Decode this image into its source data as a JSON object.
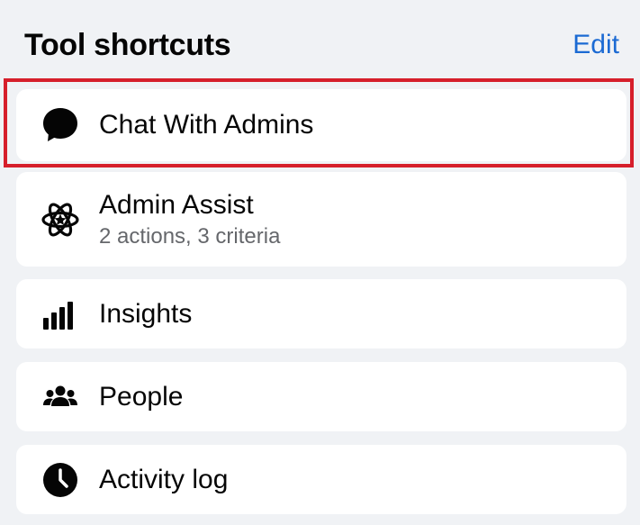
{
  "header": {
    "title": "Tool shortcuts",
    "edit_label": "Edit"
  },
  "items": [
    {
      "label": "Chat With Admins",
      "icon": "chat-bubble-icon"
    },
    {
      "label": "Admin Assist",
      "subtitle": "2 actions, 3 criteria",
      "icon": "atom-star-icon"
    },
    {
      "label": "Insights",
      "icon": "bar-chart-icon"
    },
    {
      "label": "People",
      "icon": "people-icon"
    },
    {
      "label": "Activity log",
      "icon": "clock-icon"
    }
  ],
  "colors": {
    "background": "#f0f2f5",
    "card": "#ffffff",
    "link": "#1b6ad3",
    "highlight": "#d61f2b",
    "secondary_text": "#65676b"
  }
}
